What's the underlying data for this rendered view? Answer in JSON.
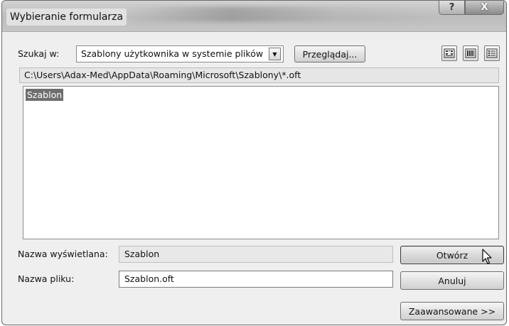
{
  "window": {
    "title": "Wybieranie formularza",
    "help_glyph": "?",
    "close_glyph": "X"
  },
  "lookin": {
    "label": "Szukaj w:",
    "value": "Szablony użytkownika w systemie plików",
    "browse_label": "Przeglądaj..."
  },
  "view_buttons": [
    "large-icons-icon",
    "small-icons-icon",
    "details-icon"
  ],
  "path": "C:\\Users\\Adax-Med\\AppData\\Roaming\\Microsoft\\Szablony\\*.oft",
  "list": {
    "items": [
      {
        "label": "Szablon",
        "selected": true
      }
    ]
  },
  "display_name": {
    "label": "Nazwa wyświetlana:",
    "value": "Szablon"
  },
  "file_name": {
    "label": "Nazwa pliku:",
    "value": "Szablon.oft"
  },
  "buttons": {
    "open": "Otwórz",
    "cancel": "Anuluj",
    "advanced": "Zaawansowane >>"
  },
  "colors": {
    "selection": "#6e6e6e",
    "dialog_bg": "#efefef"
  }
}
